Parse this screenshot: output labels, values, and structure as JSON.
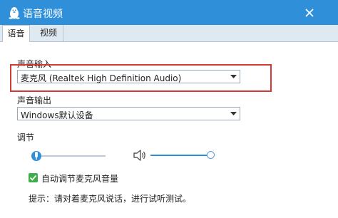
{
  "window": {
    "title": "语音视频",
    "title_bar_color": "#2f8fd8",
    "app_icon": "penguin-icon",
    "close_icon": "close-icon"
  },
  "tabs": [
    {
      "label": "语音",
      "selected": true
    },
    {
      "label": "视频",
      "selected": false
    }
  ],
  "audio_input": {
    "label": "声音输入",
    "selected_device": "麦克风 (Realtek High Definition Audio)",
    "highlight_color": "#d43a35"
  },
  "audio_output": {
    "label": "声音输出",
    "selected_device": "Windows默认设备"
  },
  "adjust": {
    "label": "调节",
    "mic_level": 0.0,
    "speaker_level": 1.0,
    "mic_icon": "microphone-icon",
    "speaker_icon": "speaker-icon"
  },
  "auto_adjust": {
    "label": "自动调节麦克风音量",
    "checked": true,
    "check_color": "#3fae49"
  },
  "hint": {
    "text": "提示：请对着麦克风说话，进行试听测试。"
  }
}
